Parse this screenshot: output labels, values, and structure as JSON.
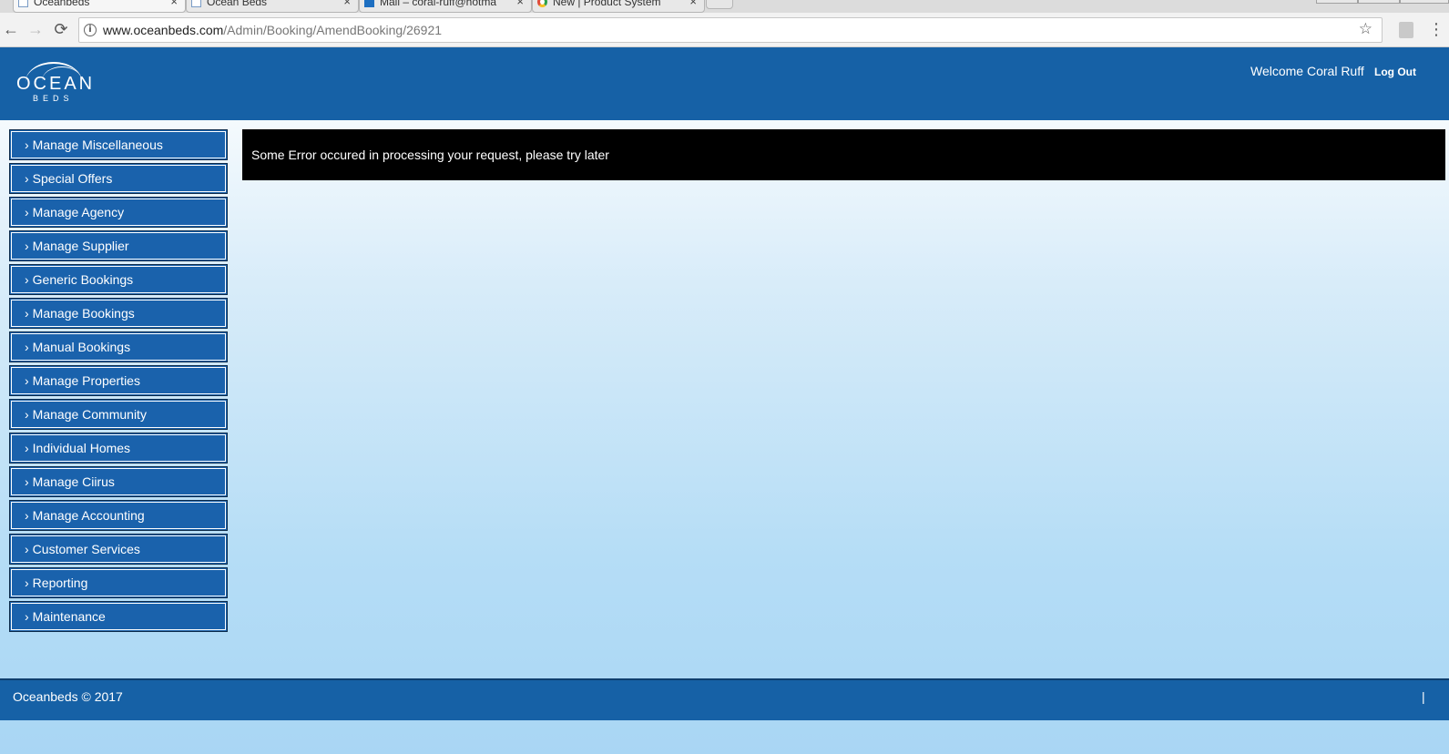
{
  "browser": {
    "tabs": [
      {
        "label": "Oceanbeds",
        "close": "×"
      },
      {
        "label": "Ocean Beds",
        "close": "×"
      },
      {
        "label": "Mail – coral-ruff@hotma",
        "close": "×"
      },
      {
        "label": "New | Product System",
        "close": "×"
      }
    ],
    "url_host": "www.oceanbeds.com",
    "url_path": "/Admin/Booking/AmendBooking/26921",
    "back_icon": "←",
    "forward_icon": "→",
    "reload_icon": "⟳",
    "star_icon": "☆",
    "menu_icon": "⋮",
    "info_icon": "i"
  },
  "header": {
    "logo_top": "OCEAN",
    "logo_bottom": "BEDS",
    "welcome": "Welcome Coral Ruff",
    "logout": "Log Out"
  },
  "sidebar": {
    "chevron": "›",
    "items": [
      {
        "label": "Manage Miscellaneous"
      },
      {
        "label": "Special Offers"
      },
      {
        "label": "Manage Agency"
      },
      {
        "label": "Manage Supplier"
      },
      {
        "label": "Generic Bookings"
      },
      {
        "label": "Manage Bookings"
      },
      {
        "label": "Manual Bookings"
      },
      {
        "label": "Manage Properties"
      },
      {
        "label": "Manage Community"
      },
      {
        "label": "Individual Homes"
      },
      {
        "label": "Manage Ciirus"
      },
      {
        "label": "Manage Accounting"
      },
      {
        "label": "Customer Services"
      },
      {
        "label": "Reporting"
      },
      {
        "label": "Maintenance"
      }
    ]
  },
  "main": {
    "error_message": "Some Error occured in processing your request, please try later"
  },
  "footer": {
    "copyright": "Oceanbeds © 2017",
    "separator": "|"
  },
  "colors": {
    "brand_blue": "#1661a6",
    "page_bg": "#a9d6f4",
    "error_bg": "#000000"
  }
}
